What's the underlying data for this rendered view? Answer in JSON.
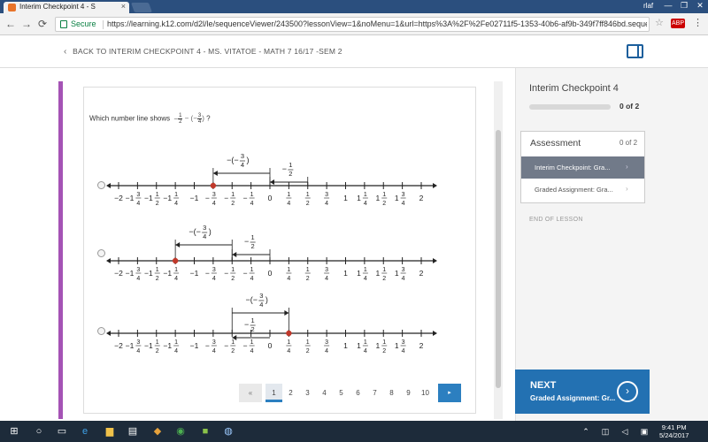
{
  "browser": {
    "tab_title": "Interim Checkpoint 4 - S",
    "tab_close": "×",
    "window_label": "rlaf",
    "window_buttons": [
      "—",
      "❐",
      "✕"
    ],
    "secure_label": "Secure",
    "url": "https://learning.k12.com/d2l/le/sequenceViewer/243500?lessonView=1&noMenu=1&url=https%3A%2F%2Fe02711f5-1353-40b6-af9b-349f7ff846bd.sequences.api.brightspace.com%2",
    "ext_label": "ABP",
    "star_icon": "☆",
    "menu_icon": "⋮",
    "nav_icons": [
      "←",
      "→",
      "⟳"
    ]
  },
  "header": {
    "back_link": "BACK TO INTERIM CHECKPOINT 4 - MS. VITATOE - MATH 7 16/17 -SEM 2"
  },
  "question": {
    "prefix": "Which number line shows",
    "suffix": "?",
    "expression": {
      "neg1": "−",
      "frac1_num": "1",
      "frac1_den": "2",
      "minus": "−",
      "open": "(−",
      "frac2_num": "3",
      "frac2_den": "4",
      "close": ")"
    }
  },
  "number_line": {
    "ticks": [
      "−2",
      "−1",
      "−1",
      "−1",
      "−1",
      "−",
      "−",
      "−",
      "0",
      "",
      "",
      "",
      "1",
      "1",
      "1",
      "1",
      "2"
    ],
    "tick_values": [
      -2,
      -1.75,
      -1.5,
      -1.25,
      -1,
      -0.75,
      -0.5,
      -0.25,
      0,
      0.25,
      0.5,
      0.75,
      1,
      1.25,
      1.5,
      1.75,
      2
    ],
    "tick_nums": [
      "",
      "3",
      "1",
      "1",
      "",
      "3",
      "1",
      "1",
      "",
      "1",
      "1",
      "3",
      "",
      "1",
      "1",
      "3",
      ""
    ],
    "tick_dens": [
      "",
      "4",
      "2",
      "4",
      "",
      "4",
      "2",
      "4",
      "",
      "4",
      "2",
      "4",
      "",
      "4",
      "2",
      "4",
      ""
    ],
    "options": [
      {
        "arrow_a": {
          "label_prefix": "−(−",
          "num": "3",
          "den": "4",
          "label_suffix": ")",
          "from": 0,
          "to": -0.75
        },
        "arrow_b": {
          "label_prefix": "−",
          "num": "1",
          "den": "2",
          "from": 0.5,
          "to": 0
        },
        "dot": -0.75
      },
      {
        "arrow_a": {
          "label_prefix": "−(−",
          "num": "3",
          "den": "4",
          "label_suffix": ")",
          "from": -0.5,
          "to": -1.25
        },
        "arrow_b": {
          "label_prefix": "−",
          "num": "1",
          "den": "2",
          "from": 0,
          "to": -0.5
        },
        "dot": -1.25
      },
      {
        "arrow_a": {
          "label_prefix": "−(−",
          "num": "3",
          "den": "4",
          "label_suffix": ")",
          "from": -0.5,
          "to": 0.25
        },
        "arrow_b": {
          "label_prefix": "−",
          "num": "1",
          "den": "2",
          "from": 0,
          "to": -0.5
        },
        "dot": 0.25
      }
    ]
  },
  "pagination": {
    "prev": "«",
    "pages": [
      "1",
      "2",
      "3",
      "4",
      "5",
      "6",
      "7",
      "8",
      "9",
      "10"
    ],
    "active_page": "1",
    "next": "▸"
  },
  "sidebar": {
    "title": "Interim Checkpoint 4",
    "progress_text": "0 of 2",
    "progress_fraction": 0,
    "assessment_title": "Assessment",
    "assessment_count": "0 of 2",
    "items": [
      {
        "label": "Interim Checkpoint: Gra...",
        "chevron": "›"
      },
      {
        "label": "Graded Assignment: Gra...",
        "chevron": "›"
      }
    ],
    "end_of_lesson": "END OF LESSON",
    "next_label": "NEXT",
    "next_sub": "Graded Assignment: Gr...",
    "next_icon": "›"
  },
  "taskbar": {
    "time": "9:41 PM",
    "date": "5/24/2017"
  },
  "colors": {
    "accent": "#2c7fc0",
    "purple_bar": "#a553b5",
    "dot": "#c0392b"
  }
}
